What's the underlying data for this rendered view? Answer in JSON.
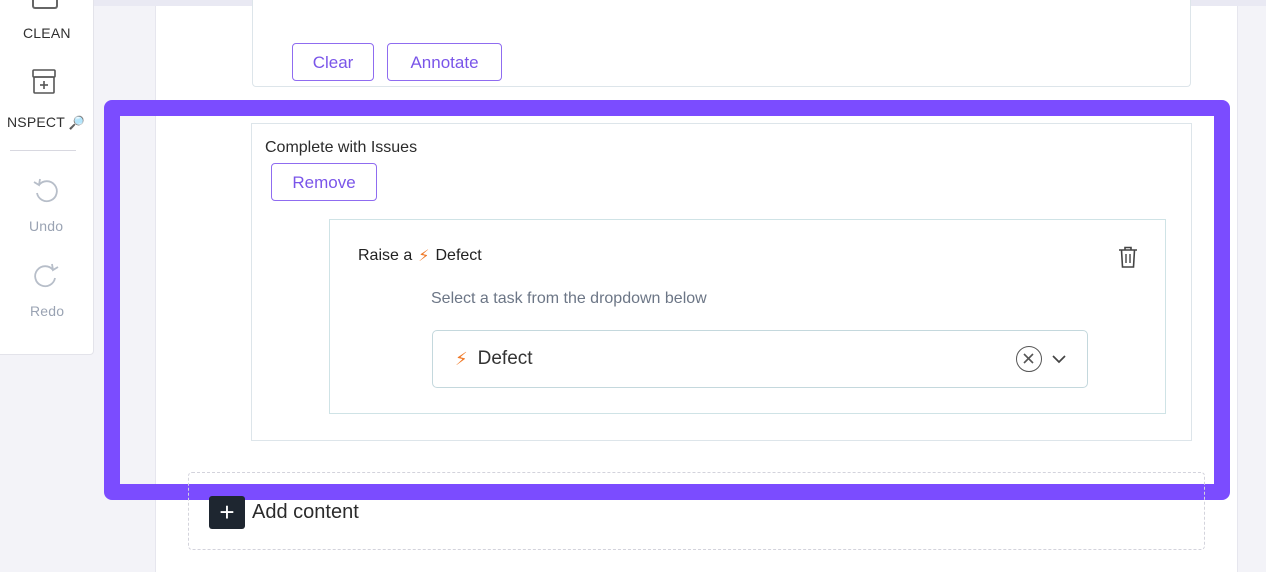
{
  "palette": {
    "clean_label": "CLEAN",
    "inspect_label": "NSPECT",
    "undo_label": "Undo",
    "redo_label": "Redo"
  },
  "top_card": {
    "clear_label": "Clear",
    "annotate_label": "Annotate"
  },
  "issue_card": {
    "title": "Complete with Issues",
    "remove_label": "Remove",
    "action": {
      "prefix": "Raise a",
      "type_label": "Defect",
      "helper_text": "Select a task from the dropdown below",
      "selected_task": "Defect"
    }
  },
  "add_content_label": "Add content",
  "colors": {
    "accent": "#7b4cff",
    "button_text": "#7a55e9",
    "bolt": "#f07a2a"
  }
}
